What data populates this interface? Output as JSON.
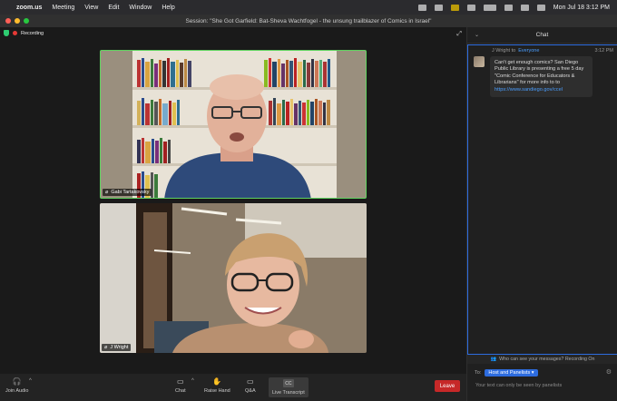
{
  "menubar": {
    "app": "zoom.us",
    "items": [
      "Meeting",
      "View",
      "Edit",
      "Window",
      "Help"
    ],
    "datetime": "Mon Jul 18  3:12 PM"
  },
  "window": {
    "title": "Session: \"She Got Garfield: Bat-Sheva Wachtfogel - the unsung trailblazer of Comics in Israel\""
  },
  "meeting": {
    "recording_label": "Recording",
    "participants": [
      {
        "name": "Gabi Tartakovsky"
      },
      {
        "name": "J Wright"
      }
    ]
  },
  "toolbar": {
    "join_audio": "Join Audio",
    "chat": "Chat",
    "raise_hand": "Raise Hand",
    "qa": "Q&A",
    "live_transcript": "Live Transcript",
    "cc_badge": "CC",
    "leave": "Leave"
  },
  "chat": {
    "title": "Chat",
    "message": {
      "sender_prefix": "J Wright to",
      "recipient": "Everyone",
      "time": "3:12 PM",
      "text": "Can't get enough comics? San Diego Public Library is presenting a free 5 day \"Comic Conference for Educators & Librarians\" for more info to to",
      "link": "https://www.sandiego.gov/ccel"
    },
    "who_can_see": "Who can see your messages? Recording On",
    "to_label": "To:",
    "recipient_select": "Host and Panelists",
    "placeholder": "Your text can only be seen by panelists"
  },
  "colors": {
    "active_speaker": "#5fd35f",
    "accent": "#2d6cdf",
    "leave": "#c62828",
    "recording": "#e53935"
  }
}
